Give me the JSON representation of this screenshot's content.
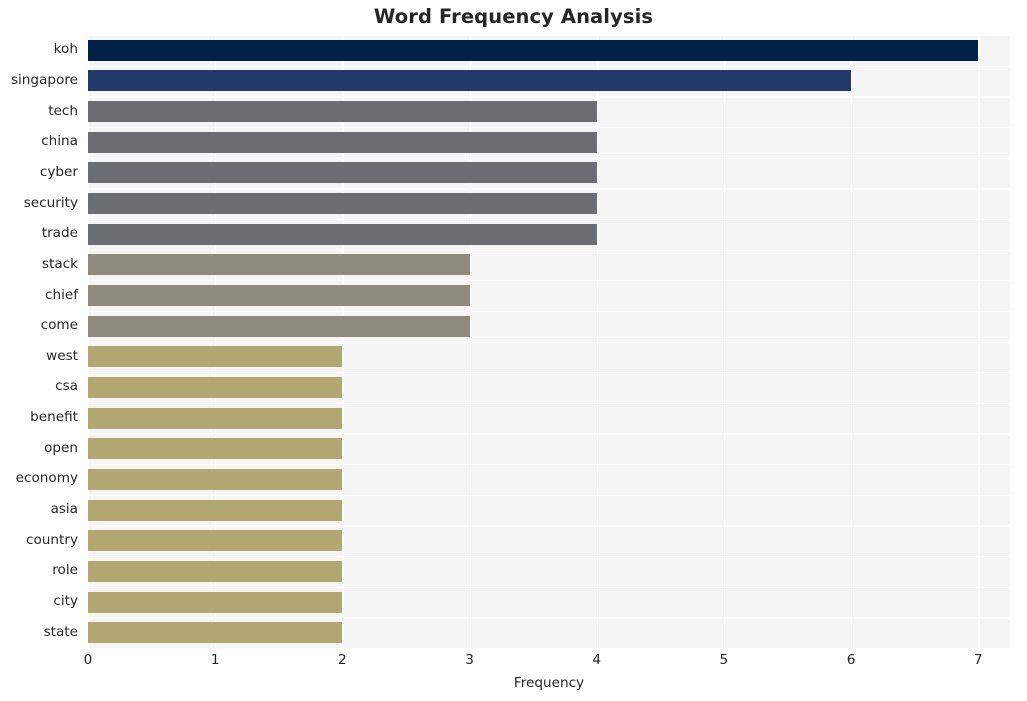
{
  "chart_data": {
    "type": "bar",
    "orientation": "horizontal",
    "title": "Word Frequency Analysis",
    "xlabel": "Frequency",
    "ylabel": "",
    "xlim": [
      0,
      7.25
    ],
    "xticks": [
      "0",
      "1",
      "2",
      "3",
      "4",
      "5",
      "6",
      "7"
    ],
    "xtick_values": [
      0,
      1,
      2,
      3,
      4,
      5,
      6,
      7
    ],
    "grid": true,
    "legend": "none",
    "categories": [
      "koh",
      "singapore",
      "tech",
      "china",
      "cyber",
      "security",
      "trade",
      "stack",
      "chief",
      "come",
      "west",
      "csa",
      "benefit",
      "open",
      "economy",
      "asia",
      "country",
      "role",
      "city",
      "state"
    ],
    "values": [
      7,
      6,
      4,
      4,
      4,
      4,
      4,
      3,
      3,
      3,
      2,
      2,
      2,
      2,
      2,
      2,
      2,
      2,
      2,
      2
    ],
    "bar_colors": [
      "#022147",
      "#23386b",
      "#6b6d73",
      "#6b6d73",
      "#6b6d73",
      "#6b6d73",
      "#6b6d73",
      "#8e8b7c",
      "#8e8b7c",
      "#8e8b7c",
      "#b2a770",
      "#b2a770",
      "#b2a770",
      "#b2a770",
      "#b2a770",
      "#b2a770",
      "#b2a770",
      "#b2a770",
      "#b2a770",
      "#b2a770"
    ]
  },
  "style": {
    "plot_background": "#f5f5f6",
    "grid_color": "#ffffff",
    "text_color": "#262626",
    "figure_background": "#ffffff"
  }
}
